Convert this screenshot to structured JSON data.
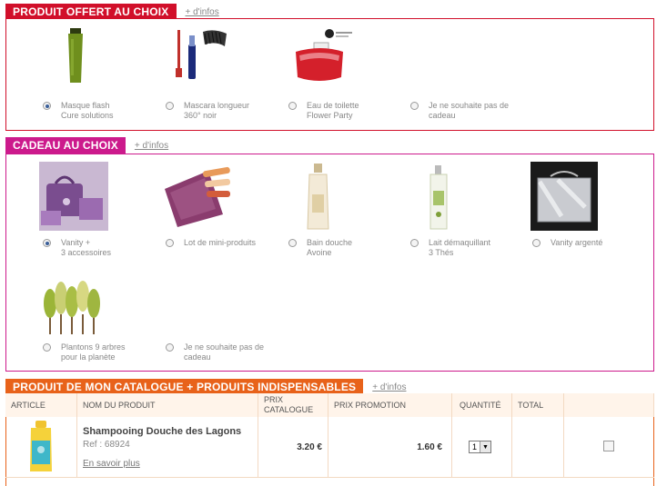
{
  "section1": {
    "title": "PRODUIT OFFERT AU CHOIX",
    "info_link": "+ d'infos",
    "color": "#d10f2a",
    "options": [
      {
        "label": "Masque flash\nCure solutions",
        "selected": true
      },
      {
        "label": "Mascara longueur\n360° noir",
        "selected": false
      },
      {
        "label": "Eau de toilette\nFlower Party",
        "selected": false
      },
      {
        "label": "Je ne souhaite pas de\ncadeau",
        "selected": false
      }
    ]
  },
  "section2": {
    "title": "CADEAU AU CHOIX",
    "info_link": "+ d'infos",
    "color": "#cc1a8c",
    "options": [
      {
        "label": "Vanity +\n3 accessoires",
        "selected": true
      },
      {
        "label": "Lot de mini-produits",
        "selected": false
      },
      {
        "label": "Bain douche\nAvoine",
        "selected": false
      },
      {
        "label": "Lait démaquillant\n3 Thés",
        "selected": false
      },
      {
        "label": "Vanity argenté",
        "selected": false
      },
      {
        "label": "Plantons 9 arbres\npour la planète",
        "selected": false
      },
      {
        "label": "Je ne souhaite pas de\ncadeau",
        "selected": false
      }
    ]
  },
  "section3": {
    "title": "PRODUIT DE MON CATALOGUE + PRODUITS INDISPENSABLES",
    "info_link": "+ d'infos",
    "color": "#e8621a",
    "columns": {
      "article": "ARTICLE",
      "name": "NOM DU PRODUIT",
      "catalogue_price": "PRIX\nCATALOGUE",
      "promo_price": "PRIX PROMOTION",
      "quantity": "QUANTITÉ",
      "total": "TOTAL"
    },
    "rows": [
      {
        "name": "Shampooing Douche des Lagons",
        "ref": "Ref : 68924",
        "more_link": "En savoir plus",
        "catalogue_price": "3.20 €",
        "promo_price": "1.60 €",
        "quantity": "1",
        "total": ""
      }
    ]
  }
}
